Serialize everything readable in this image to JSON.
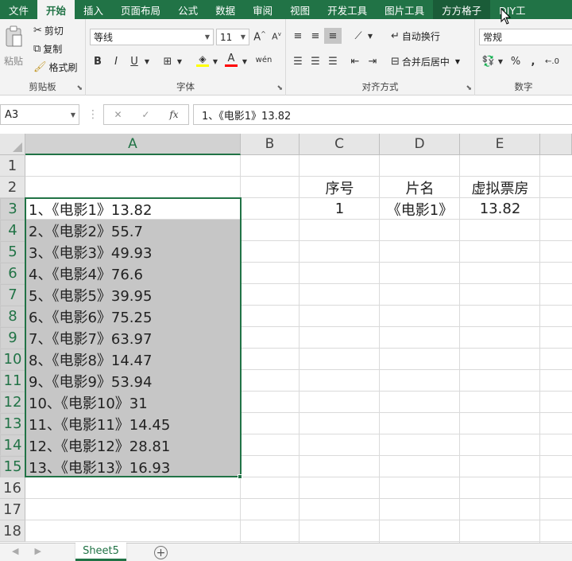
{
  "tabs": [
    {
      "label": "文件"
    },
    {
      "label": "开始",
      "active": true
    },
    {
      "label": "插入"
    },
    {
      "label": "页面布局"
    },
    {
      "label": "公式"
    },
    {
      "label": "数据"
    },
    {
      "label": "审阅"
    },
    {
      "label": "视图"
    },
    {
      "label": "开发工具"
    },
    {
      "label": "图片工具"
    },
    {
      "label": "方方格子"
    },
    {
      "label": "DIY工"
    }
  ],
  "clipboard": {
    "paste": "粘贴",
    "cut": "剪切",
    "copy": "复制",
    "format_painter": "格式刷",
    "group_label": "剪贴板"
  },
  "font": {
    "name": "等线",
    "size": "11",
    "group_label": "字体",
    "bold": "B",
    "italic": "I",
    "underline": "U"
  },
  "alignment": {
    "wrap_text": "自动换行",
    "merge_center": "合并后居中",
    "group_label": "对齐方式"
  },
  "number": {
    "format": "常规",
    "percent": "%",
    "comma": ",",
    "group_label": "数字"
  },
  "formula_bar": {
    "name_box": "A3",
    "content": "1、《电影1》13.82",
    "fx": "fx"
  },
  "columns": [
    "A",
    "B",
    "C",
    "D",
    "E"
  ],
  "rows": [
    "1",
    "2",
    "3",
    "4",
    "5",
    "6",
    "7",
    "8",
    "9",
    "10",
    "11",
    "12",
    "13",
    "14",
    "15",
    "16",
    "17",
    "18"
  ],
  "cells": {
    "A": [
      "1、《电影1》13.82",
      "2、《电影2》55.7",
      "3、《电影3》49.93",
      "4、《电影4》76.6",
      "5、《电影5》39.95",
      "6、《电影6》75.25",
      "7、《电影7》63.97",
      "8、《电影8》14.47",
      "9、《电影9》53.94",
      "10、《电影10》31",
      "11、《电影11》14.45",
      "12、《电影12》28.81",
      "13、《电影13》16.93"
    ],
    "C2": "序号",
    "D2": "片名",
    "E2": "虚拟票房",
    "C3": "1",
    "D3": "《电影1》",
    "E3": "13.82"
  },
  "sheet": {
    "name": "Sheet5",
    "add": "+"
  }
}
